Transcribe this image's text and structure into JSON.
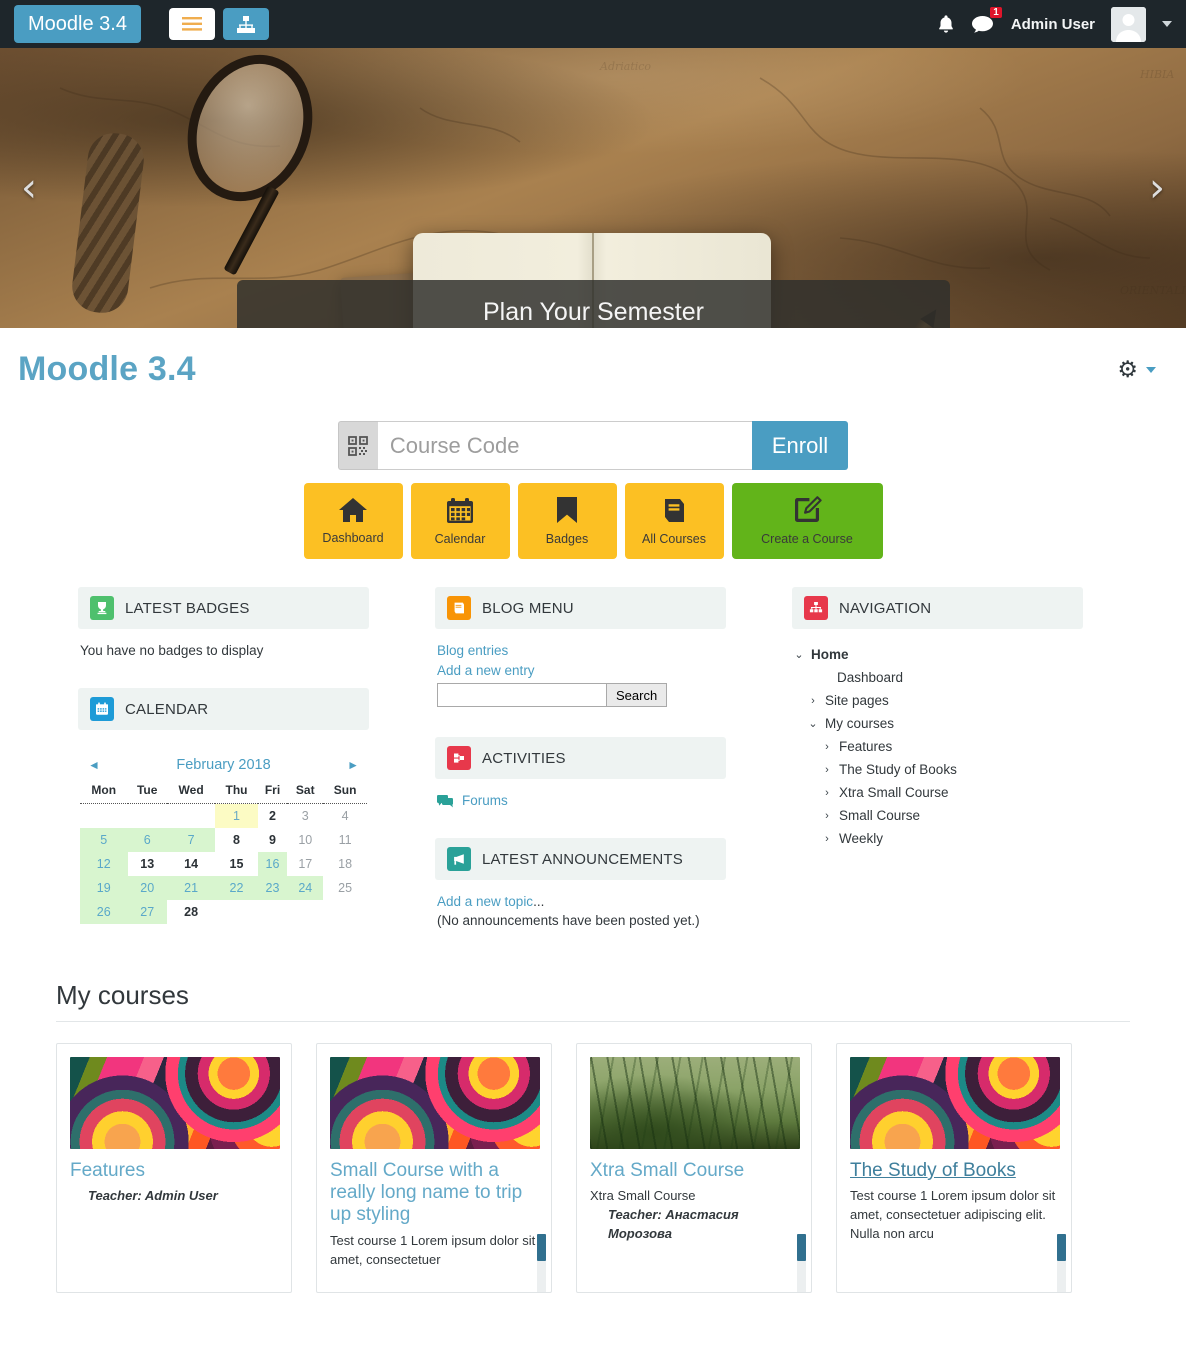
{
  "navbar": {
    "brand": "Moodle 3.4",
    "menu_icon": "hamburger-icon",
    "sitemap_icon": "sitemap-icon",
    "notifications_icon": "bell-icon",
    "messages_icon": "message-icon",
    "message_count": "1",
    "username": "Admin User",
    "avatar": "user-avatar"
  },
  "carousel": {
    "caption": "Plan Your Semester",
    "prev_label": "‹",
    "next_label": "›",
    "indicators": [
      {
        "active": false
      },
      {
        "active": true
      },
      {
        "active": false
      }
    ]
  },
  "page": {
    "title": "Moodle 3.4",
    "gear_icon": "gear-icon"
  },
  "enroll": {
    "addon_icon": "qrcode-icon",
    "placeholder": "Course Code",
    "value": "",
    "button_label": "Enroll"
  },
  "quicklinks": [
    {
      "label": "Dashboard",
      "icon": "home-icon",
      "color": "#fcc023"
    },
    {
      "label": "Calendar",
      "icon": "calendar-icon",
      "color": "#fcc023"
    },
    {
      "label": "Badges",
      "icon": "bookmark-icon",
      "color": "#fcc023"
    },
    {
      "label": "All Courses",
      "icon": "book-icon",
      "color": "#fcc023"
    },
    {
      "label": "Create a Course",
      "icon": "edit-square-icon",
      "color": "#62b41a"
    }
  ],
  "badges_block": {
    "title": "LATEST BADGES",
    "icon": "trophy-icon",
    "icon_color": "#4ec06d",
    "empty_text": "You have no badges to display"
  },
  "calendar_block": {
    "title": "CALENDAR",
    "icon": "calendar-icon",
    "icon_color": "#1e9bd7",
    "month": "February 2018",
    "prev": "◄",
    "next": "►",
    "weekdays": [
      "Mon",
      "Tue",
      "Wed",
      "Thu",
      "Fri",
      "Sat",
      "Sun"
    ],
    "weeks": [
      [
        {
          "d": "",
          "t": ""
        },
        {
          "d": "",
          "t": ""
        },
        {
          "d": "",
          "t": ""
        },
        {
          "d": "1",
          "t": "today"
        },
        {
          "d": "2",
          "t": "wk"
        },
        {
          "d": "3",
          "t": "we"
        },
        {
          "d": "4",
          "t": "we"
        }
      ],
      [
        {
          "d": "5",
          "t": "ev"
        },
        {
          "d": "6",
          "t": "ev"
        },
        {
          "d": "7",
          "t": "ev"
        },
        {
          "d": "8",
          "t": "wk"
        },
        {
          "d": "9",
          "t": "wk"
        },
        {
          "d": "10",
          "t": "we"
        },
        {
          "d": "11",
          "t": "we"
        }
      ],
      [
        {
          "d": "12",
          "t": "ev"
        },
        {
          "d": "13",
          "t": "wk"
        },
        {
          "d": "14",
          "t": "wk"
        },
        {
          "d": "15",
          "t": "wk"
        },
        {
          "d": "16",
          "t": "ev"
        },
        {
          "d": "17",
          "t": "we"
        },
        {
          "d": "18",
          "t": "we"
        }
      ],
      [
        {
          "d": "19",
          "t": "ev"
        },
        {
          "d": "20",
          "t": "ev"
        },
        {
          "d": "21",
          "t": "ev"
        },
        {
          "d": "22",
          "t": "ev"
        },
        {
          "d": "23",
          "t": "ev"
        },
        {
          "d": "24",
          "t": "ev"
        },
        {
          "d": "25",
          "t": "we"
        }
      ],
      [
        {
          "d": "26",
          "t": "ev"
        },
        {
          "d": "27",
          "t": "ev"
        },
        {
          "d": "28",
          "t": "wk"
        },
        {
          "d": "",
          "t": ""
        },
        {
          "d": "",
          "t": ""
        },
        {
          "d": "",
          "t": ""
        },
        {
          "d": "",
          "t": ""
        }
      ]
    ]
  },
  "blog_block": {
    "title": "BLOG MENU",
    "icon": "blog-book-icon",
    "icon_color": "#f89406",
    "links": [
      "Blog entries",
      "Add a new entry"
    ],
    "search_value": "",
    "search_button": "Search"
  },
  "activities_block": {
    "title": "ACTIVITIES",
    "icon": "activities-icon",
    "icon_color": "#e7384b",
    "items": [
      {
        "label": "Forums",
        "icon": "forum-icon"
      }
    ]
  },
  "announcements_block": {
    "title": "LATEST ANNOUNCEMENTS",
    "icon": "megaphone-icon",
    "icon_color": "#2aa198",
    "add_link": "Add a new topic",
    "add_link_suffix": "...",
    "empty_text": "(No announcements have been posted yet.)"
  },
  "navigation_block": {
    "title": "NAVIGATION",
    "icon": "sitemap-icon",
    "icon_color": "#e7384b",
    "items": [
      {
        "label": "Home",
        "level": 1,
        "toggle": "⌄",
        "link": true,
        "bold": true
      },
      {
        "label": "Dashboard",
        "level": 2,
        "toggle": "",
        "link": true,
        "bold": false
      },
      {
        "label": "Site pages",
        "level": 3,
        "toggle": "›",
        "link": false,
        "bold": false
      },
      {
        "label": "My courses",
        "level": 3,
        "toggle": "⌄",
        "link": false,
        "bold": false
      },
      {
        "label": "Features",
        "level": 4,
        "toggle": "›",
        "link": true,
        "bold": false
      },
      {
        "label": "The Study of Books",
        "level": 4,
        "toggle": "›",
        "link": true,
        "bold": false
      },
      {
        "label": "Xtra Small Course",
        "level": 4,
        "toggle": "›",
        "link": true,
        "bold": false
      },
      {
        "label": "Small Course",
        "level": 4,
        "toggle": "›",
        "link": true,
        "bold": false
      },
      {
        "label": "Weekly",
        "level": 4,
        "toggle": "›",
        "link": true,
        "bold": false
      }
    ]
  },
  "mycourses": {
    "heading": "My courses",
    "cards": [
      {
        "title": "Features",
        "thumb": "swirl",
        "summary": "",
        "teacher": "Teacher: Admin User",
        "scrollbar": false,
        "hover": false
      },
      {
        "title": "Small Course with a really long name to trip up styling",
        "thumb": "swirl",
        "summary": "Test course 1 Lorem ipsum dolor sit amet, consectetuer",
        "teacher": "",
        "scrollbar": true,
        "hover": false
      },
      {
        "title": "Xtra Small Course",
        "thumb": "grass",
        "summary": "Xtra Small Course",
        "teacher": "Teacher: Анастасия Морозова",
        "scrollbar": true,
        "hover": false
      },
      {
        "title": "The Study of Books",
        "thumb": "swirl",
        "summary": "Test course 1 Lorem ipsum dolor sit amet, consectetuer adipiscing elit. Nulla non arcu",
        "teacher": "",
        "scrollbar": true,
        "hover": true
      }
    ]
  },
  "colors": {
    "brand_blue": "#4a9dc2",
    "navbar_dark": "#1e262b",
    "amber": "#fcc023",
    "green": "#62b41a",
    "block_header": "#eef3f2",
    "event_green": "#d8f5cf",
    "today_yellow": "#fcfbc4",
    "badge_red": "#e0152b"
  }
}
